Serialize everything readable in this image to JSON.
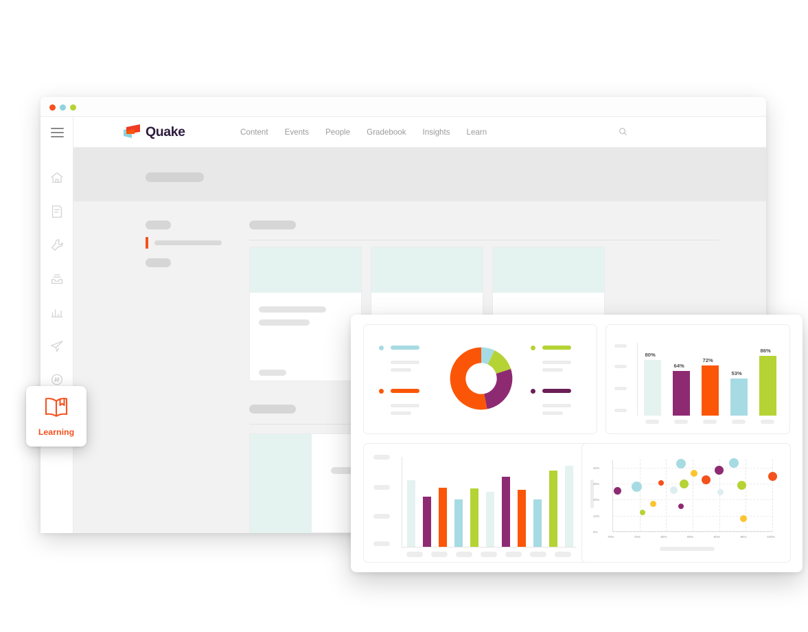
{
  "window": {
    "traffic_lights": [
      {
        "name": "close",
        "color": "#f4511e"
      },
      {
        "name": "minimize",
        "color": "#8ed3dd"
      },
      {
        "name": "maximize",
        "color": "#b5d334"
      }
    ]
  },
  "brand": {
    "name": "Quake",
    "mark_colors": {
      "flag": "#ef3b24",
      "flag_dark": "#f4511e",
      "sheet": "#8ed3dd"
    },
    "text_color": "#2d1b3c"
  },
  "topnav": {
    "links": [
      "Content",
      "Events",
      "People",
      "Gradebook",
      "Insights",
      "Learn"
    ],
    "search_icon": "search-icon"
  },
  "sidebar": {
    "menu_icon": "hamburger-icon",
    "items": [
      {
        "icon": "home-icon",
        "label": ""
      },
      {
        "icon": "note-icon",
        "label": ""
      },
      {
        "icon": "wrench-icon",
        "label": ""
      },
      {
        "icon": "inbox-tray-icon",
        "label": ""
      },
      {
        "icon": "bar-chart-icon",
        "label": ""
      },
      {
        "icon": "paper-plane-icon",
        "label": ""
      },
      {
        "icon": "hashtag-chat-icon",
        "label": ""
      }
    ]
  },
  "filterbar": {
    "search_placeholder": "",
    "search_value": "",
    "search_icon": "search-icon"
  },
  "badge": {
    "label": "Learning",
    "icon": "open-book-icon",
    "color": "#f4511e"
  },
  "palette": {
    "orange": "#fb5607",
    "purple": "#8e2a72",
    "green": "#b5d334",
    "blue": "#a6dbe3",
    "pale": "#e4f2f0",
    "yellow": "#fdc431",
    "red_orange": "#f4511e"
  },
  "chart_data": [
    {
      "id": "donut",
      "type": "pie",
      "title": "",
      "donut": true,
      "categories": [
        "Blue",
        "Green",
        "Purple",
        "Orange"
      ],
      "values": [
        7,
        13,
        27,
        53
      ],
      "colors": [
        "#a6dbe3",
        "#b5d334",
        "#8e2a72",
        "#fb5607"
      ],
      "legend_position": "left-and-right",
      "legend": [
        {
          "label": "",
          "color": "#a6dbe3"
        },
        {
          "label": "",
          "color": "#b5d334"
        },
        {
          "label": "",
          "color": "#fb5607"
        },
        {
          "label": "",
          "color": "#6b1f56"
        }
      ]
    },
    {
      "id": "percent-bars",
      "type": "bar",
      "title": "",
      "categories": [
        "",
        "",
        "",
        "",
        ""
      ],
      "values": [
        80,
        64,
        72,
        53,
        86
      ],
      "data_labels": [
        "80%",
        "64%",
        "72%",
        "53%",
        "86%"
      ],
      "colors": [
        "#e4f2f0",
        "#8e2a72",
        "#fb5607",
        "#a6dbe3",
        "#b5d334"
      ],
      "ylim": [
        0,
        100
      ],
      "grid": false,
      "xlabel": "",
      "ylabel": ""
    },
    {
      "id": "multi-bars",
      "type": "bar",
      "title": "",
      "categories": [
        "",
        "",
        "",
        "",
        "",
        "",
        "",
        "",
        "",
        "",
        ""
      ],
      "values": [
        74,
        56,
        66,
        53,
        65,
        61,
        78,
        63,
        53,
        85,
        90
      ],
      "colors": [
        "#e4f2f0",
        "#8e2a72",
        "#fb5607",
        "#a6dbe3",
        "#b5d334",
        "#e4f2f0",
        "#8e2a72",
        "#fb5607",
        "#a6dbe3",
        "#b5d334",
        "#e4f2f0"
      ],
      "ylim": [
        0,
        100
      ],
      "grid": false,
      "xlabel": "",
      "ylabel": ""
    },
    {
      "id": "scatter",
      "type": "scatter",
      "title": "",
      "xlabel": "",
      "ylabel": "",
      "xlim": [
        70,
        100
      ],
      "ylim": [
        0,
        45
      ],
      "xticks": [
        "70%",
        "75%",
        "80%",
        "85%",
        "90%",
        "95%",
        "100%"
      ],
      "yticks": [
        "0%",
        "10%",
        "20%",
        "30%",
        "40%"
      ],
      "grid": true,
      "points": [
        {
          "x": 70.8,
          "y": 25.5,
          "r": 5.5,
          "color": "#8e2a72"
        },
        {
          "x": 74.5,
          "y": 28.0,
          "r": 7.5,
          "color": "#a6dbe3"
        },
        {
          "x": 75.5,
          "y": 12.0,
          "r": 4.0,
          "color": "#b5d334"
        },
        {
          "x": 77.5,
          "y": 17.5,
          "r": 4.5,
          "color": "#fdc431"
        },
        {
          "x": 79.0,
          "y": 30.5,
          "r": 4.0,
          "color": "#f4511e"
        },
        {
          "x": 81.5,
          "y": 26.0,
          "r": 5.5,
          "color": "#ddeef0"
        },
        {
          "x": 82.8,
          "y": 42.5,
          "r": 7.0,
          "color": "#a6dbe3"
        },
        {
          "x": 82.8,
          "y": 16.0,
          "r": 4.0,
          "color": "#8e2a72"
        },
        {
          "x": 83.4,
          "y": 30.0,
          "r": 6.5,
          "color": "#b5d334"
        },
        {
          "x": 85.2,
          "y": 36.5,
          "r": 5.0,
          "color": "#fdc431"
        },
        {
          "x": 87.5,
          "y": 32.5,
          "r": 6.5,
          "color": "#f4511e"
        },
        {
          "x": 90.0,
          "y": 38.5,
          "r": 6.5,
          "color": "#8e2a72"
        },
        {
          "x": 90.2,
          "y": 24.5,
          "r": 4.5,
          "color": "#ddeef0"
        },
        {
          "x": 92.8,
          "y": 43.0,
          "r": 7.0,
          "color": "#a6dbe3"
        },
        {
          "x": 94.2,
          "y": 29.0,
          "r": 6.5,
          "color": "#b5d334"
        },
        {
          "x": 94.6,
          "y": 8.0,
          "r": 5.0,
          "color": "#fdc431"
        },
        {
          "x": 100.0,
          "y": 34.5,
          "r": 6.5,
          "color": "#f4511e"
        }
      ]
    }
  ]
}
